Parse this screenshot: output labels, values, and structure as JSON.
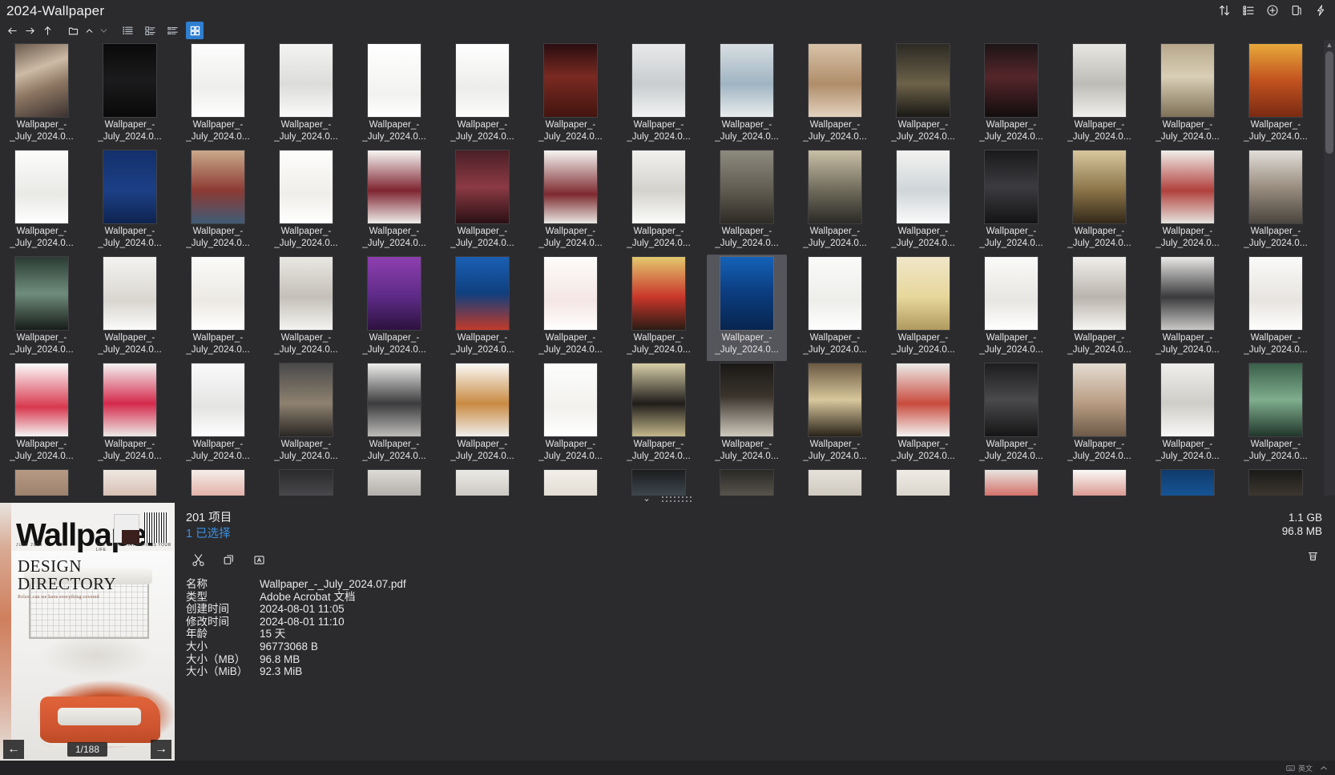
{
  "window": {
    "title": "2024-Wallpaper"
  },
  "title_tools": [
    {
      "name": "sort-icon",
      "label": "排序"
    },
    {
      "name": "list-view-icon",
      "label": "列表"
    },
    {
      "name": "add-icon",
      "label": "添加"
    },
    {
      "name": "clipboard-icon",
      "label": "剪贴板"
    },
    {
      "name": "lightning-icon",
      "label": "快捷"
    }
  ],
  "navbar": {
    "back": {
      "name": "back-arrow-icon",
      "label": "后退"
    },
    "forward": {
      "name": "forward-arrow-icon",
      "label": "前进"
    },
    "up": {
      "name": "up-arrow-icon",
      "label": "上一级"
    },
    "folder": {
      "name": "folder-icon",
      "label": "文件夹"
    },
    "caret_up": {
      "name": "caret-up-icon",
      "label": "向上"
    },
    "caret_down": {
      "name": "caret-down-icon",
      "label": "向下"
    },
    "views": [
      {
        "name": "view-list-icon",
        "label": "列表视图",
        "active": false
      },
      {
        "name": "view-details-icon",
        "label": "详细信息",
        "active": false
      },
      {
        "name": "view-compact-icon",
        "label": "紧凑视图",
        "active": false
      },
      {
        "name": "view-thumbnails-icon",
        "label": "缩略图视图",
        "active": true
      }
    ]
  },
  "grid": {
    "columns": 15,
    "rows": 5,
    "file_label_line1": "Wallpaper_-",
    "file_label_line2": "_July_2024.0...",
    "selected_index": 38,
    "thumbs": [
      "linear-gradient(160deg,#6b5a4c 0%,#cdbba6 35%,#8d7662 60%,#3b3230 100%)",
      "linear-gradient(180deg,#0a0a0a 0%,#1b1b1d 50%,#090909 100%)",
      "linear-gradient(180deg,#fdfdfd 0%,#eeeeec 60%,#ffffff 100%)",
      "linear-gradient(180deg,#f4f4f3 0%,#dcdcda 55%,#fafafa 100%)",
      "linear-gradient(180deg,#ffffff 0%,#f2f2f0 70%,#ffffff 100%)",
      "linear-gradient(180deg,#ffffff 0%,#ededeb 60%,#fbfbfa 100%)",
      "linear-gradient(180deg,#2a0d10 0%,#7a2a22 45%,#43140f 100%)",
      "linear-gradient(180deg,#e8e9ea 0%,#c9cdd0 55%,#f1f2f2 100%)",
      "linear-gradient(180deg,#d8dee2 0%,#9fb4c2 55%,#e8eced 100%)",
      "linear-gradient(180deg,#d8c3a8 0%,#b08d6a 55%,#e2d2be 100%)",
      "linear-gradient(180deg,#2c2a24 0%,#6d6249 55%,#191814 100%)",
      "linear-gradient(180deg,#1c1416 0%,#55262a 45%,#120d0e 100%)",
      "linear-gradient(180deg,#e7e6e2 0%,#bdbcb6 55%,#f0efec 100%)",
      "linear-gradient(180deg,#b7a88c 0%,#d9cfb6 45%,#7e7157 100%)",
      "linear-gradient(180deg,#e8a93a 0%,#c2521f 50%,#7a2a12 100%)",
      "linear-gradient(180deg,#fcfcfb 0%,#e9e9e6 60%,#ffffff 100%)",
      "linear-gradient(180deg,#13306b 0%,#1c3f86 55%,#0e2450 100%)",
      "linear-gradient(180deg,#caa98a 0%,#8c3a33 55%,#3f5c77 100%)",
      "linear-gradient(180deg,#fdfdfc 0%,#f0eeea 60%,#ffffff 100%)",
      "linear-gradient(180deg,#f7f6f4 0%,#7e2430 55%,#efedea 100%)",
      "linear-gradient(180deg,#4b1f26 0%,#8c3a44 50%,#2a1014 100%)",
      "linear-gradient(180deg,#f6f5f3 0%,#7d2a2f 60%,#e9e7e3 100%)",
      "linear-gradient(180deg,#f2f1ef 0%,#d4d2cd 55%,#fbfbfa 100%)",
      "linear-gradient(180deg,#8d8a7e 0%,#5f5b50 55%,#2e2b26 100%)",
      "linear-gradient(180deg,#c9bfa6 0%,#6e6a5a 55%,#2b2a26 100%)",
      "linear-gradient(180deg,#f3f3f1 0%,#cfd5d8 55%,#fafafa 100%)",
      "linear-gradient(180deg,#1a1a1c 0%,#3c3c40 50%,#141416 100%)",
      "linear-gradient(180deg,#d8c79e 0%,#8a7347 55%,#33291a 100%)",
      "linear-gradient(180deg,#f0eeea 0%,#b1403c 55%,#e6e3de 100%)",
      "linear-gradient(180deg,#e2ded8 0%,#9a8e80 50%,#4b453e 100%)",
      "linear-gradient(180deg,#2a3b33 0%,#6f8d7c 50%,#171c19 100%)",
      "linear-gradient(180deg,#f4f3f1 0%,#d9d6d0 60%,#fbfbfa 100%)",
      "linear-gradient(180deg,#fbfbfa 0%,#ece9e3 60%,#ffffff 100%)",
      "linear-gradient(180deg,#e9e7e2 0%,#c4c0b8 55%,#f4f3f1 100%)",
      "linear-gradient(180deg,#8e3fb0 0%,#5d2a86 55%,#2d123f 100%)",
      "linear-gradient(180deg,#1a5fb4 0%,#0f3f7e 50%,#c23a2a 100%)",
      "linear-gradient(180deg,#fdfcfa 0%,#f4e6e4 60%,#fffefd 100%)",
      "linear-gradient(180deg,#e3c86e 0%,#c9362a 55%,#2a1c14 100%)",
      "linear-gradient(180deg,#1462b8 0%,#0c3f83 45%,#07254f 100%)",
      "linear-gradient(180deg,#fbfbfa 0%,#ededea 60%,#ffffff 100%)",
      "linear-gradient(180deg,#f0e6c8 0%,#e7d79b 55%,#b09a5e 100%)",
      "linear-gradient(180deg,#fafaf9 0%,#e8e6e2 60%,#ffffff 100%)",
      "linear-gradient(180deg,#f1efec 0%,#b9b4ac 55%,#f6f5f3 100%)",
      "linear-gradient(180deg,#e9e8e6 0%,#3a3a3c 55%,#c9c8c6 100%)",
      "linear-gradient(180deg,#fafaf8 0%,#e7e4e0 60%,#fefefd 100%)",
      "linear-gradient(180deg,#fbfbfa 0%,#d8384e 60%,#f4f4f3 100%)",
      "linear-gradient(180deg,#f3f3f2 0%,#d4294b 55%,#eceae7 100%)",
      "linear-gradient(180deg,#fafafa 0%,#e4e4e3 60%,#fefefe 100%)",
      "linear-gradient(180deg,#4a4a4a 0%,#8e8170 55%,#2a2724 100%)",
      "linear-gradient(180deg,#efefed 0%,#3b3b3d 55%,#bdbcb9 100%)",
      "linear-gradient(180deg,#fbfaf8 0%,#c98a42 55%,#f0efec 100%)",
      "linear-gradient(180deg,#fdfdfc 0%,#f2f1ee 60%,#ffffff 100%)",
      "linear-gradient(180deg,#d8cfa8 0%,#1f1d1a 55%,#c3b78b 100%)",
      "linear-gradient(180deg,#1a1816 0%,#3a342c 45%,#cfc9bd 100%)",
      "linear-gradient(180deg,#6b5942 0%,#d8c79c 50%,#2b2319 100%)",
      "linear-gradient(180deg,#ecebe8 0%,#c94b3e 55%,#f4f3f1 100%)",
      "linear-gradient(180deg,#1c1c1e 0%,#4a4a4c 50%,#151516 100%)",
      "linear-gradient(180deg,#e5dcd2 0%,#b89c82 55%,#6d5a48 100%)",
      "linear-gradient(180deg,#efeeec 0%,#cfcdc8 55%,#f8f8f7 100%)",
      "linear-gradient(180deg,#3a5f4a 0%,#7fae8d 50%,#20362a 100%)",
      "linear-gradient(180deg,#b79a84 0%,#8d7360 55%,#4e4038 100%)",
      "linear-gradient(180deg,#f0e9e2 0%,#c9a79a 55%,#e6ded6 100%)",
      "linear-gradient(180deg,#f6eeea 0%,#d88f84 55%,#efe6e1 100%)",
      "linear-gradient(180deg,#2a2a2c 0%,#555458 50%,#1a1a1c 100%)",
      "linear-gradient(180deg,#dedbd6 0%,#9a9793 55%,#4a4846 100%)",
      "linear-gradient(180deg,#eceae6 0%,#b9b5ae 55%,#f2f1ef 100%)",
      "linear-gradient(180deg,#f3f0ea 0%,#d9d2c6 55%,#fbfaf8 100%)",
      "linear-gradient(180deg,#1c1c1e 0%,#4c5a62 50%,#121214 100%)",
      "linear-gradient(180deg,#2a2926 0%,#6a665c 50%,#1a1a18 100%)",
      "linear-gradient(180deg,#e6e2da 0%,#c2bcb0 55%,#f3f1ed 100%)",
      "linear-gradient(180deg,#efece6 0%,#cfc9bd 55%,#faf9f6 100%)",
      "linear-gradient(180deg,#e8e5e0 0%,#c92f28 55%,#f0eeea 100%)",
      "linear-gradient(180deg,#fbfaf8 0%,#c8655a 55%,#f2f0ec 100%)",
      "linear-gradient(180deg,#0f3a6b 0%,#1a5fa8 50%,#0a2443 100%)",
      "linear-gradient(180deg,#1b1a18 0%,#4a4338 50%,#12110f 100%)"
    ]
  },
  "splitter": {
    "collapse": {
      "name": "chevron-down-icon",
      "glyph": "⌄"
    }
  },
  "preview": {
    "masthead": "Wallpaper",
    "masthead_star": "*",
    "issue_tag": "JULY 2024",
    "strapline": "THE STUFF THAT REFINES YOUR LIFE",
    "headline_1": "DESIGN",
    "headline_2": "DIRECTORY",
    "subhead": "Relax: can we have everything covered",
    "page_indicator": "1/188",
    "prev": {
      "name": "prev-page-arrow-icon",
      "glyph": "←"
    },
    "next": {
      "name": "next-page-arrow-icon",
      "glyph": "→"
    }
  },
  "info": {
    "item_count": "201 项目",
    "selected_count": "1 已选择",
    "actions": [
      {
        "name": "cut-icon",
        "label": "剪切"
      },
      {
        "name": "copy-icon",
        "label": "复制"
      },
      {
        "name": "rename-icon",
        "label": "重命名"
      }
    ],
    "metadata": [
      {
        "key": "名称",
        "value": "Wallpaper_-_July_2024.07.pdf"
      },
      {
        "key": "类型",
        "value": "Adobe Acrobat 文档"
      },
      {
        "key": "创建时间",
        "value": "2024-08-01  11:05"
      },
      {
        "key": "修改时间",
        "value": "2024-08-01  11:10"
      },
      {
        "key": "年龄",
        "value": "15 天"
      },
      {
        "key": "大小",
        "value": "96773068 B"
      },
      {
        "key": "大小（MB）",
        "value": "96.8 MB"
      },
      {
        "key": "大小（MiB）",
        "value": "92.3 MiB"
      }
    ],
    "total_size": "1.1 GB",
    "selected_size": "96.8 MB",
    "delete": {
      "name": "trash-icon",
      "label": "删除"
    }
  },
  "statusbar": {
    "items": [
      {
        "name": "keyboard-layout-icon",
        "label": "英文"
      },
      {
        "name": "caret-up-icon",
        "label": "展开"
      }
    ]
  },
  "colors": {
    "window_bg": "#2b2b2e",
    "accent": "#2f7fd1",
    "link": "#3b8fe0",
    "selection_bg": "#55555c",
    "statusbar_bg": "#232326",
    "scrollbar_track": "#323236",
    "scrollbar_thumb": "#5a5a60"
  }
}
